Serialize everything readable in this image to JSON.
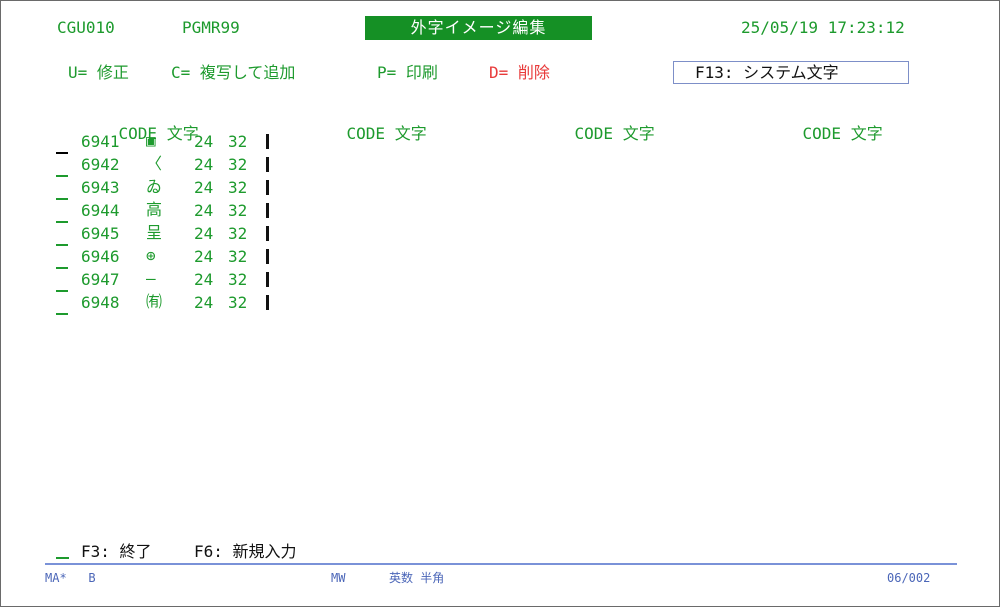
{
  "header": {
    "program_id": "CGU010",
    "program_name": "PGMR99",
    "title": "外字イメージ編集",
    "datetime": "25/05/19 17:23:12"
  },
  "actions": {
    "u": "U= 修正",
    "c": "C= 複写して追加",
    "p": "P= 印刷",
    "d": "D= 削除",
    "f13": "F13: システム文字"
  },
  "columns": [
    {
      "code": "CODE",
      "char": "文字"
    },
    {
      "code": "CODE",
      "char": "文字"
    },
    {
      "code": "CODE",
      "char": "文字"
    },
    {
      "code": "CODE",
      "char": "文字"
    }
  ],
  "rows": [
    {
      "code": "6941",
      "char": "▣",
      "width": "24",
      "height": "32"
    },
    {
      "code": "6942",
      "char": "〈",
      "width": "24",
      "height": "32"
    },
    {
      "code": "6943",
      "char": "ゐ",
      "width": "24",
      "height": "32"
    },
    {
      "code": "6944",
      "char": "高",
      "width": "24",
      "height": "32"
    },
    {
      "code": "6945",
      "char": "呈",
      "width": "24",
      "height": "32"
    },
    {
      "code": "6946",
      "char": "⊕",
      "width": "24",
      "height": "32"
    },
    {
      "code": "6947",
      "char": "—",
      "width": "24",
      "height": "32"
    },
    {
      "code": "6948",
      "char": "㈲",
      "width": "24",
      "height": "32"
    }
  ],
  "footer": {
    "f3": "F3: 終了",
    "f6": "F6: 新規入力",
    "status_left": "MA*   B",
    "status_mid": "MW",
    "status_mode": "英数 半角",
    "status_page": "06/002"
  }
}
